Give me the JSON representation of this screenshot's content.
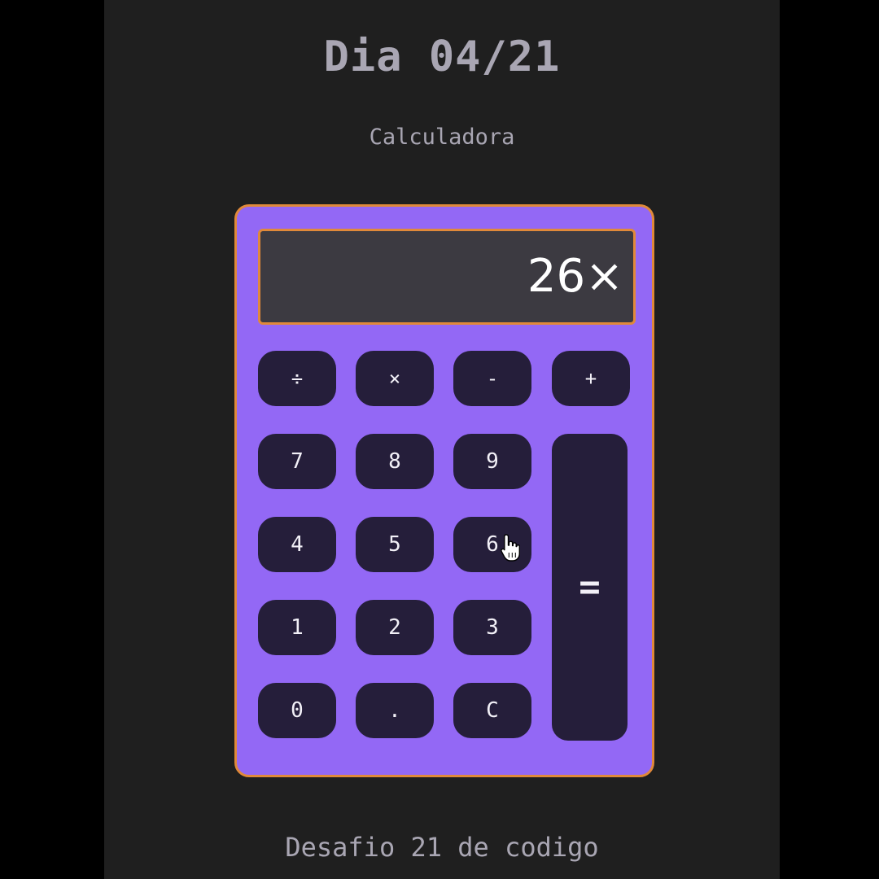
{
  "header": {
    "title": "Dia 04/21",
    "subtitle": "Calculadora"
  },
  "display": {
    "value": "26×"
  },
  "keys": {
    "divide": "÷",
    "multiply": "×",
    "minus": "-",
    "plus": "+",
    "seven": "7",
    "eight": "8",
    "nine": "9",
    "four": "4",
    "five": "5",
    "six": "6",
    "one": "1",
    "two": "2",
    "three": "3",
    "zero": "0",
    "dot": ".",
    "clear": "C",
    "equals": "="
  },
  "footer": {
    "text": "Desafio 21 de codigo"
  },
  "colors": {
    "page_background": "#1f1f1f",
    "calculator_body": "#9368f5",
    "accent_border": "#e0893a",
    "display_background": "#3c3a41",
    "key_background": "#251e3a",
    "text_muted": "#a9a6b3"
  },
  "icons": {
    "cursor": "hand-pointer-icon"
  }
}
